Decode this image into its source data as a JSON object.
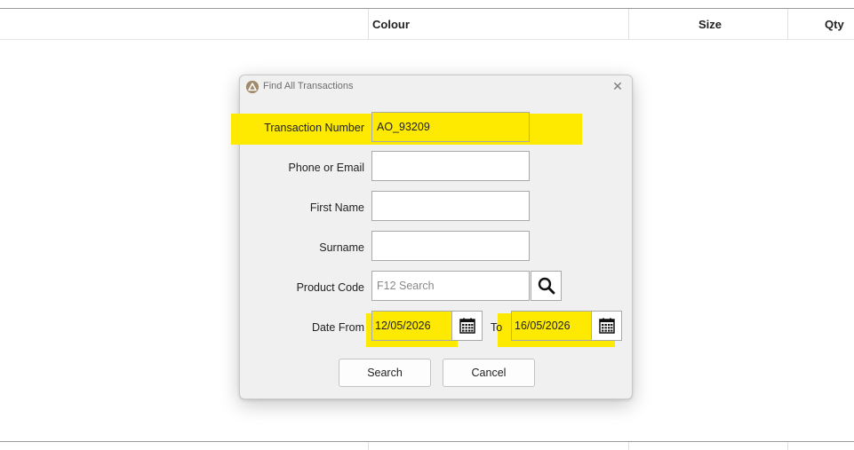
{
  "table": {
    "columns": [
      "Colour",
      "Size",
      "Qty"
    ]
  },
  "dialog": {
    "title": "Find All Transactions",
    "close_glyph": "✕",
    "fields": {
      "transaction_number": {
        "label": "Transaction Number",
        "value": "AO_93209"
      },
      "phone_or_email": {
        "label": "Phone or Email",
        "value": ""
      },
      "first_name": {
        "label": "First Name",
        "value": ""
      },
      "surname": {
        "label": "Surname",
        "value": ""
      },
      "product_code": {
        "label": "Product Code",
        "value": "",
        "placeholder": "F12 Search"
      },
      "date_from": {
        "label": "Date From",
        "value": "12/05/2026"
      },
      "date_to": {
        "label": "To",
        "value": "16/05/2026"
      }
    },
    "buttons": {
      "search": "Search",
      "cancel": "Cancel"
    },
    "highlight_color": "#fdea00"
  }
}
